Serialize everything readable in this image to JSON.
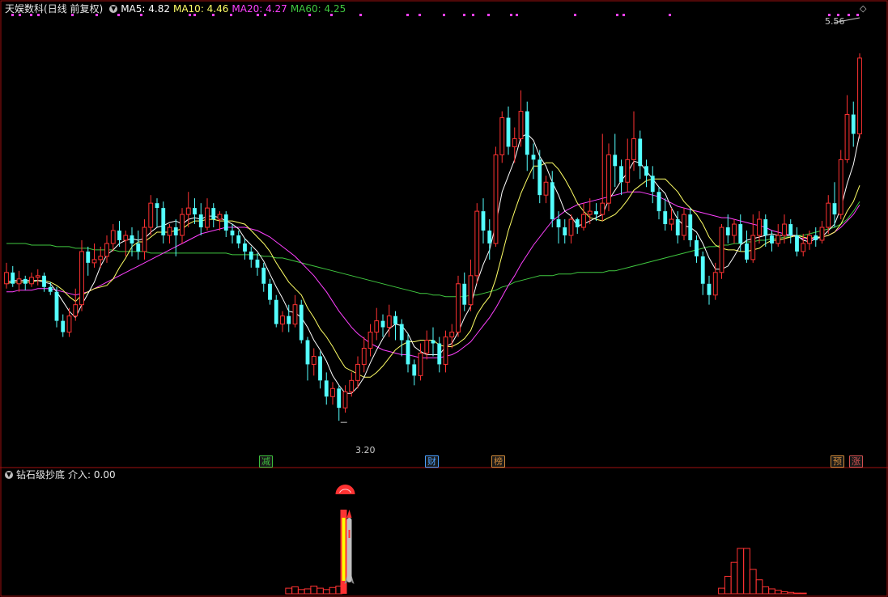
{
  "main_header": {
    "title": "天娱数科",
    "mode": "(日线 前复权)",
    "ma5": "MA5: 4.82",
    "ma10": "MA10: 4.46",
    "ma20": "MA20: 4.27",
    "ma60": "MA60: 4.25"
  },
  "sub_header": {
    "indicator": "钻石级抄底",
    "value": "介入: 0.00"
  },
  "annotations": {
    "high": "5.56",
    "low": "3.20"
  },
  "tags": [
    {
      "text": "减",
      "color": "#3dbf3d"
    },
    {
      "text": "财",
      "color": "#4aa0ff"
    },
    {
      "text": "榜",
      "color": "#d08a3a"
    },
    {
      "text": "预",
      "color": "#d08a3a"
    },
    {
      "text": "涨",
      "color": "#d05050"
    }
  ],
  "colors": {
    "up": "#ff3232",
    "down": "#54ffff",
    "ma5": "#ffffff",
    "ma10": "#ffff66",
    "ma20": "#ff40ff",
    "ma60": "#40c840",
    "grid": "#a01010"
  },
  "chart_data": {
    "type": "candlestick",
    "ylim": [
      3.0,
      5.7
    ],
    "candles": [
      [
        4.05,
        4.12,
        4.02,
        4.18
      ],
      [
        4.12,
        4.05,
        4.03,
        4.16
      ],
      [
        4.05,
        4.08,
        4.0,
        4.13
      ],
      [
        4.08,
        4.05,
        4.01,
        4.1
      ],
      [
        4.05,
        4.09,
        4.03,
        4.12
      ],
      [
        4.09,
        4.1,
        4.04,
        4.14
      ],
      [
        4.1,
        4.03,
        4.0,
        4.12
      ],
      [
        4.03,
        4.0,
        3.98,
        4.06
      ],
      [
        4.0,
        3.82,
        3.78,
        4.03
      ],
      [
        3.82,
        3.75,
        3.72,
        3.86
      ],
      [
        3.75,
        3.85,
        3.72,
        3.9
      ],
      [
        3.85,
        3.92,
        3.82,
        4.02
      ],
      [
        3.92,
        4.25,
        3.88,
        4.32
      ],
      [
        4.25,
        4.18,
        4.1,
        4.28
      ],
      [
        4.18,
        4.2,
        4.15,
        4.3
      ],
      [
        4.2,
        4.22,
        4.15,
        4.28
      ],
      [
        4.22,
        4.3,
        4.18,
        4.35
      ],
      [
        4.3,
        4.38,
        4.25,
        4.42
      ],
      [
        4.38,
        4.32,
        4.28,
        4.44
      ],
      [
        4.32,
        4.35,
        4.22,
        4.38
      ],
      [
        4.35,
        4.3,
        4.22,
        4.4
      ],
      [
        4.3,
        4.25,
        4.2,
        4.38
      ],
      [
        4.25,
        4.4,
        4.2,
        4.45
      ],
      [
        4.4,
        4.55,
        4.35,
        4.6
      ],
      [
        4.55,
        4.52,
        4.4,
        4.58
      ],
      [
        4.52,
        4.35,
        4.3,
        4.56
      ],
      [
        4.35,
        4.4,
        4.3,
        4.42
      ],
      [
        4.4,
        4.35,
        4.22,
        4.45
      ],
      [
        4.35,
        4.48,
        4.3,
        4.52
      ],
      [
        4.48,
        4.52,
        4.4,
        4.62
      ],
      [
        4.52,
        4.48,
        4.42,
        4.58
      ],
      [
        4.48,
        4.4,
        4.35,
        4.55
      ],
      [
        4.4,
        4.52,
        4.38,
        4.58
      ],
      [
        4.52,
        4.45,
        4.4,
        4.55
      ],
      [
        4.45,
        4.48,
        4.38,
        4.5
      ],
      [
        4.48,
        4.38,
        4.34,
        4.5
      ],
      [
        4.38,
        4.35,
        4.3,
        4.42
      ],
      [
        4.35,
        4.3,
        4.27,
        4.38
      ],
      [
        4.3,
        4.25,
        4.2,
        4.33
      ],
      [
        4.25,
        4.2,
        4.15,
        4.28
      ],
      [
        4.2,
        4.15,
        4.1,
        4.24
      ],
      [
        4.15,
        4.05,
        4.0,
        4.18
      ],
      [
        4.05,
        3.95,
        3.92,
        4.08
      ],
      [
        3.95,
        3.8,
        3.78,
        3.98
      ],
      [
        3.8,
        3.85,
        3.75,
        3.88
      ],
      [
        3.85,
        3.8,
        3.75,
        3.92
      ],
      [
        3.8,
        3.92,
        3.78,
        3.98
      ],
      [
        3.92,
        3.7,
        3.68,
        3.95
      ],
      [
        3.7,
        3.55,
        3.45,
        3.72
      ],
      [
        3.55,
        3.6,
        3.48,
        3.65
      ],
      [
        3.6,
        3.45,
        3.4,
        3.63
      ],
      [
        3.45,
        3.35,
        3.3,
        3.5
      ],
      [
        3.35,
        3.4,
        3.3,
        3.44
      ],
      [
        3.4,
        3.28,
        3.2,
        3.42
      ],
      [
        3.28,
        3.38,
        3.25,
        3.42
      ],
      [
        3.38,
        3.45,
        3.35,
        3.5
      ],
      [
        3.45,
        3.55,
        3.4,
        3.6
      ],
      [
        3.55,
        3.65,
        3.5,
        3.72
      ],
      [
        3.65,
        3.75,
        3.6,
        3.8
      ],
      [
        3.75,
        3.82,
        3.7,
        3.9
      ],
      [
        3.82,
        3.78,
        3.72,
        3.86
      ],
      [
        3.78,
        3.85,
        3.72,
        3.92
      ],
      [
        3.85,
        3.8,
        3.7,
        3.88
      ],
      [
        3.8,
        3.7,
        3.6,
        3.83
      ],
      [
        3.7,
        3.55,
        3.5,
        3.74
      ],
      [
        3.55,
        3.48,
        3.42,
        3.58
      ],
      [
        3.48,
        3.62,
        3.45,
        3.68
      ],
      [
        3.62,
        3.7,
        3.58,
        3.76
      ],
      [
        3.7,
        3.68,
        3.6,
        3.78
      ],
      [
        3.68,
        3.55,
        3.5,
        3.72
      ],
      [
        3.55,
        3.72,
        3.5,
        3.76
      ],
      [
        3.72,
        3.75,
        3.65,
        3.8
      ],
      [
        3.75,
        4.05,
        3.72,
        4.1
      ],
      [
        4.05,
        3.92,
        3.88,
        4.12
      ],
      [
        3.92,
        4.1,
        3.88,
        4.2
      ],
      [
        4.1,
        4.5,
        4.05,
        4.55
      ],
      [
        4.5,
        4.38,
        4.3,
        4.58
      ],
      [
        4.38,
        4.3,
        4.2,
        4.45
      ],
      [
        4.3,
        4.85,
        4.28,
        4.9
      ],
      [
        4.85,
        5.08,
        4.8,
        5.12
      ],
      [
        5.08,
        4.9,
        4.85,
        5.15
      ],
      [
        4.9,
        4.95,
        4.8,
        5.02
      ],
      [
        4.95,
        5.12,
        4.9,
        5.25
      ],
      [
        5.12,
        4.85,
        4.75,
        5.18
      ],
      [
        4.85,
        4.82,
        4.7,
        4.92
      ],
      [
        4.82,
        4.6,
        4.55,
        4.88
      ],
      [
        4.6,
        4.68,
        4.55,
        4.72
      ],
      [
        4.68,
        4.45,
        4.4,
        4.75
      ],
      [
        4.45,
        4.4,
        4.3,
        4.5
      ],
      [
        4.4,
        4.35,
        4.3,
        4.45
      ],
      [
        4.35,
        4.45,
        4.3,
        4.48
      ],
      [
        4.45,
        4.4,
        4.36,
        4.46
      ],
      [
        4.4,
        4.48,
        4.38,
        4.55
      ],
      [
        4.48,
        4.5,
        4.42,
        4.58
      ],
      [
        4.5,
        4.48,
        4.44,
        4.55
      ],
      [
        4.48,
        4.55,
        4.44,
        4.98
      ],
      [
        4.55,
        4.85,
        4.5,
        4.92
      ],
      [
        4.85,
        4.78,
        4.65,
        4.98
      ],
      [
        4.78,
        4.68,
        4.6,
        4.82
      ],
      [
        4.68,
        4.82,
        4.62,
        4.95
      ],
      [
        4.82,
        4.95,
        4.75,
        5.12
      ],
      [
        4.95,
        4.78,
        4.7,
        5.0
      ],
      [
        4.78,
        4.72,
        4.65,
        4.82
      ],
      [
        4.72,
        4.62,
        4.55,
        4.78
      ],
      [
        4.62,
        4.5,
        4.45,
        4.65
      ],
      [
        4.5,
        4.42,
        4.38,
        4.58
      ],
      [
        4.42,
        4.45,
        4.38,
        4.52
      ],
      [
        4.45,
        4.35,
        4.3,
        4.5
      ],
      [
        4.35,
        4.48,
        4.32,
        4.52
      ],
      [
        4.48,
        4.32,
        4.28,
        4.52
      ],
      [
        4.32,
        4.22,
        4.18,
        4.35
      ],
      [
        4.22,
        4.05,
        3.98,
        4.25
      ],
      [
        4.05,
        3.98,
        3.92,
        4.1
      ],
      [
        3.98,
        4.12,
        3.95,
        4.18
      ],
      [
        4.12,
        4.4,
        4.08,
        4.42
      ],
      [
        4.4,
        4.35,
        4.3,
        4.48
      ],
      [
        4.35,
        4.42,
        4.3,
        4.45
      ],
      [
        4.42,
        4.3,
        4.25,
        4.48
      ],
      [
        4.3,
        4.2,
        4.18,
        4.38
      ],
      [
        4.2,
        4.35,
        4.18,
        4.48
      ],
      [
        4.35,
        4.45,
        4.3,
        4.5
      ],
      [
        4.45,
        4.35,
        4.28,
        4.48
      ],
      [
        4.35,
        4.3,
        4.25,
        4.38
      ],
      [
        4.3,
        4.35,
        4.28,
        4.42
      ],
      [
        4.35,
        4.42,
        4.3,
        4.48
      ],
      [
        4.42,
        4.35,
        4.3,
        4.45
      ],
      [
        4.35,
        4.25,
        4.22,
        4.4
      ],
      [
        4.25,
        4.3,
        4.22,
        4.36
      ],
      [
        4.3,
        4.35,
        4.26,
        4.38
      ],
      [
        4.35,
        4.32,
        4.28,
        4.4
      ],
      [
        4.32,
        4.4,
        4.3,
        4.44
      ],
      [
        4.4,
        4.55,
        4.36,
        4.6
      ],
      [
        4.55,
        4.48,
        4.4,
        4.68
      ],
      [
        4.48,
        4.82,
        4.45,
        4.88
      ],
      [
        4.82,
        5.1,
        4.8,
        5.22
      ],
      [
        5.1,
        4.98,
        4.9,
        5.18
      ],
      [
        4.98,
        5.45,
        4.95,
        5.48
      ]
    ],
    "ma5": [
      4.06,
      4.07,
      4.07,
      4.07,
      4.07,
      4.07,
      4.06,
      4.05,
      4.0,
      3.94,
      3.88,
      3.84,
      3.92,
      3.99,
      4.06,
      4.16,
      4.23,
      4.26,
      4.3,
      4.32,
      4.33,
      4.32,
      4.33,
      4.37,
      4.4,
      4.41,
      4.43,
      4.44,
      4.42,
      4.45,
      4.46,
      4.45,
      4.47,
      4.47,
      4.46,
      4.44,
      4.42,
      4.39,
      4.33,
      4.29,
      4.25,
      4.19,
      4.11,
      4.03,
      3.96,
      3.88,
      3.87,
      3.84,
      3.78,
      3.7,
      3.64,
      3.57,
      3.48,
      3.42,
      3.37,
      3.37,
      3.41,
      3.47,
      3.56,
      3.64,
      3.71,
      3.77,
      3.8,
      3.79,
      3.74,
      3.66,
      3.63,
      3.61,
      3.61,
      3.61,
      3.66,
      3.68,
      3.75,
      3.84,
      3.91,
      4.06,
      4.17,
      4.26,
      4.42,
      4.62,
      4.72,
      4.82,
      4.96,
      4.98,
      4.94,
      4.84,
      4.78,
      4.68,
      4.6,
      4.5,
      4.47,
      4.41,
      4.42,
      4.44,
      4.46,
      4.48,
      4.57,
      4.63,
      4.69,
      4.74,
      4.81,
      4.8,
      4.75,
      4.7,
      4.65,
      4.61,
      4.52,
      4.45,
      4.41,
      4.4,
      4.37,
      4.3,
      4.21,
      4.14,
      4.14,
      4.16,
      4.22,
      4.29,
      4.32,
      4.33,
      4.34,
      4.35,
      4.36,
      4.35,
      4.35,
      4.35,
      4.35,
      4.32,
      4.31,
      4.33,
      4.34,
      4.38,
      4.42,
      4.52,
      4.67,
      4.79,
      4.98
    ],
    "ma10": [
      4.05,
      4.06,
      4.06,
      4.06,
      4.06,
      4.07,
      4.07,
      4.06,
      4.04,
      4.01,
      3.97,
      3.94,
      3.98,
      4.0,
      4.02,
      4.03,
      4.04,
      4.08,
      4.15,
      4.21,
      4.28,
      4.31,
      4.31,
      4.34,
      4.37,
      4.37,
      4.37,
      4.38,
      4.39,
      4.42,
      4.44,
      4.44,
      4.45,
      4.45,
      4.44,
      4.44,
      4.44,
      4.43,
      4.42,
      4.38,
      4.34,
      4.3,
      4.25,
      4.18,
      4.12,
      4.06,
      4.02,
      3.98,
      3.9,
      3.84,
      3.77,
      3.72,
      3.66,
      3.59,
      3.53,
      3.51,
      3.49,
      3.47,
      3.47,
      3.5,
      3.54,
      3.59,
      3.64,
      3.67,
      3.69,
      3.69,
      3.7,
      3.7,
      3.7,
      3.67,
      3.66,
      3.66,
      3.68,
      3.71,
      3.76,
      3.86,
      3.92,
      3.97,
      4.08,
      4.23,
      4.38,
      4.5,
      4.61,
      4.7,
      4.78,
      4.78,
      4.8,
      4.8,
      4.76,
      4.7,
      4.63,
      4.55,
      4.5,
      4.46,
      4.45,
      4.44,
      4.46,
      4.48,
      4.52,
      4.57,
      4.63,
      4.66,
      4.69,
      4.7,
      4.7,
      4.7,
      4.66,
      4.62,
      4.56,
      4.52,
      4.48,
      4.42,
      4.34,
      4.29,
      4.27,
      4.26,
      4.26,
      4.25,
      4.25,
      4.26,
      4.27,
      4.3,
      4.32,
      4.32,
      4.33,
      4.34,
      4.35,
      4.34,
      4.33,
      4.34,
      4.34,
      4.35,
      4.37,
      4.42,
      4.5,
      4.56,
      4.66
    ],
    "ma20": [
      4.0,
      4.0,
      4.01,
      4.01,
      4.01,
      4.02,
      4.02,
      4.02,
      4.01,
      4.0,
      3.99,
      3.98,
      3.99,
      4.0,
      4.02,
      4.04,
      4.06,
      4.08,
      4.1,
      4.12,
      4.14,
      4.16,
      4.18,
      4.2,
      4.22,
      4.24,
      4.26,
      4.28,
      4.3,
      4.32,
      4.34,
      4.36,
      4.37,
      4.38,
      4.39,
      4.4,
      4.4,
      4.4,
      4.4,
      4.39,
      4.38,
      4.36,
      4.34,
      4.31,
      4.28,
      4.25,
      4.22,
      4.18,
      4.14,
      4.1,
      4.05,
      4.0,
      3.94,
      3.88,
      3.83,
      3.78,
      3.74,
      3.71,
      3.68,
      3.66,
      3.64,
      3.63,
      3.62,
      3.61,
      3.61,
      3.6,
      3.59,
      3.59,
      3.59,
      3.59,
      3.6,
      3.61,
      3.63,
      3.66,
      3.69,
      3.74,
      3.79,
      3.84,
      3.9,
      3.97,
      4.04,
      4.1,
      4.17,
      4.23,
      4.29,
      4.34,
      4.39,
      4.44,
      4.47,
      4.5,
      4.52,
      4.54,
      4.55,
      4.56,
      4.57,
      4.58,
      4.59,
      4.6,
      4.61,
      4.62,
      4.62,
      4.62,
      4.61,
      4.6,
      4.59,
      4.57,
      4.55,
      4.53,
      4.52,
      4.51,
      4.5,
      4.49,
      4.48,
      4.47,
      4.46,
      4.46,
      4.45,
      4.44,
      4.43,
      4.42,
      4.41,
      4.4,
      4.38,
      4.37,
      4.36,
      4.35,
      4.34,
      4.33,
      4.33,
      4.33,
      4.34,
      4.35,
      4.37,
      4.4,
      4.44,
      4.48,
      4.54
    ],
    "ma60": [
      4.3,
      4.3,
      4.3,
      4.3,
      4.29,
      4.29,
      4.29,
      4.29,
      4.28,
      4.28,
      4.28,
      4.27,
      4.27,
      4.27,
      4.26,
      4.26,
      4.26,
      4.26,
      4.25,
      4.25,
      4.25,
      4.25,
      4.25,
      4.24,
      4.24,
      4.24,
      4.24,
      4.24,
      4.24,
      4.24,
      4.24,
      4.24,
      4.24,
      4.24,
      4.24,
      4.24,
      4.23,
      4.23,
      4.23,
      4.23,
      4.23,
      4.22,
      4.22,
      4.21,
      4.21,
      4.2,
      4.19,
      4.18,
      4.17,
      4.16,
      4.15,
      4.14,
      4.13,
      4.12,
      4.11,
      4.1,
      4.09,
      4.08,
      4.07,
      4.06,
      4.05,
      4.04,
      4.03,
      4.02,
      4.01,
      4.0,
      3.99,
      3.99,
      3.98,
      3.98,
      3.97,
      3.97,
      3.97,
      3.97,
      3.98,
      3.98,
      3.99,
      4.0,
      4.01,
      4.03,
      4.04,
      4.06,
      4.07,
      4.08,
      4.09,
      4.1,
      4.1,
      4.1,
      4.11,
      4.11,
      4.11,
      4.12,
      4.12,
      4.12,
      4.12,
      4.12,
      4.13,
      4.13,
      4.14,
      4.15,
      4.16,
      4.17,
      4.18,
      4.19,
      4.2,
      4.21,
      4.22,
      4.23,
      4.24,
      4.25,
      4.26,
      4.27,
      4.28,
      4.28,
      4.29,
      4.29,
      4.3,
      4.3,
      4.31,
      4.31,
      4.32,
      4.32,
      4.33,
      4.33,
      4.34,
      4.34,
      4.35,
      4.35,
      4.36,
      4.37,
      4.38,
      4.39,
      4.4,
      4.42,
      4.45,
      4.5,
      4.56
    ],
    "indicator_bars": [
      0,
      0,
      0,
      0,
      0,
      0,
      0,
      0,
      0,
      0,
      0,
      0,
      0,
      0,
      0,
      0,
      0,
      0,
      0,
      0,
      0,
      0,
      0,
      0,
      0,
      0,
      0,
      0,
      0,
      0,
      0,
      0,
      0,
      0,
      0,
      0,
      0,
      0,
      0,
      0,
      0,
      0,
      0,
      0,
      0,
      0.8,
      1.0,
      0.6,
      0.7,
      1.1,
      0.8,
      0.6,
      0.9,
      1.1,
      15,
      0,
      0,
      0,
      0,
      0,
      0,
      0,
      0,
      0,
      0,
      0,
      0,
      0,
      0,
      0,
      0,
      0,
      0,
      0,
      0,
      0,
      0,
      0,
      0,
      0,
      0,
      0,
      0,
      0,
      0,
      0,
      0,
      0,
      0,
      0,
      0,
      0,
      0,
      0,
      0,
      0,
      0,
      0,
      0,
      0,
      0,
      0,
      0,
      0,
      0,
      0,
      0,
      0,
      0,
      0,
      0,
      0,
      0,
      0,
      0.8,
      2.5,
      4.5,
      6.5,
      6.5,
      3.5,
      2.0,
      1.0,
      0.7,
      0.5,
      0.3,
      0.2,
      0.1,
      0.1,
      0,
      0,
      0,
      0,
      0,
      0,
      0,
      0,
      0
    ],
    "signal_index": 54
  }
}
